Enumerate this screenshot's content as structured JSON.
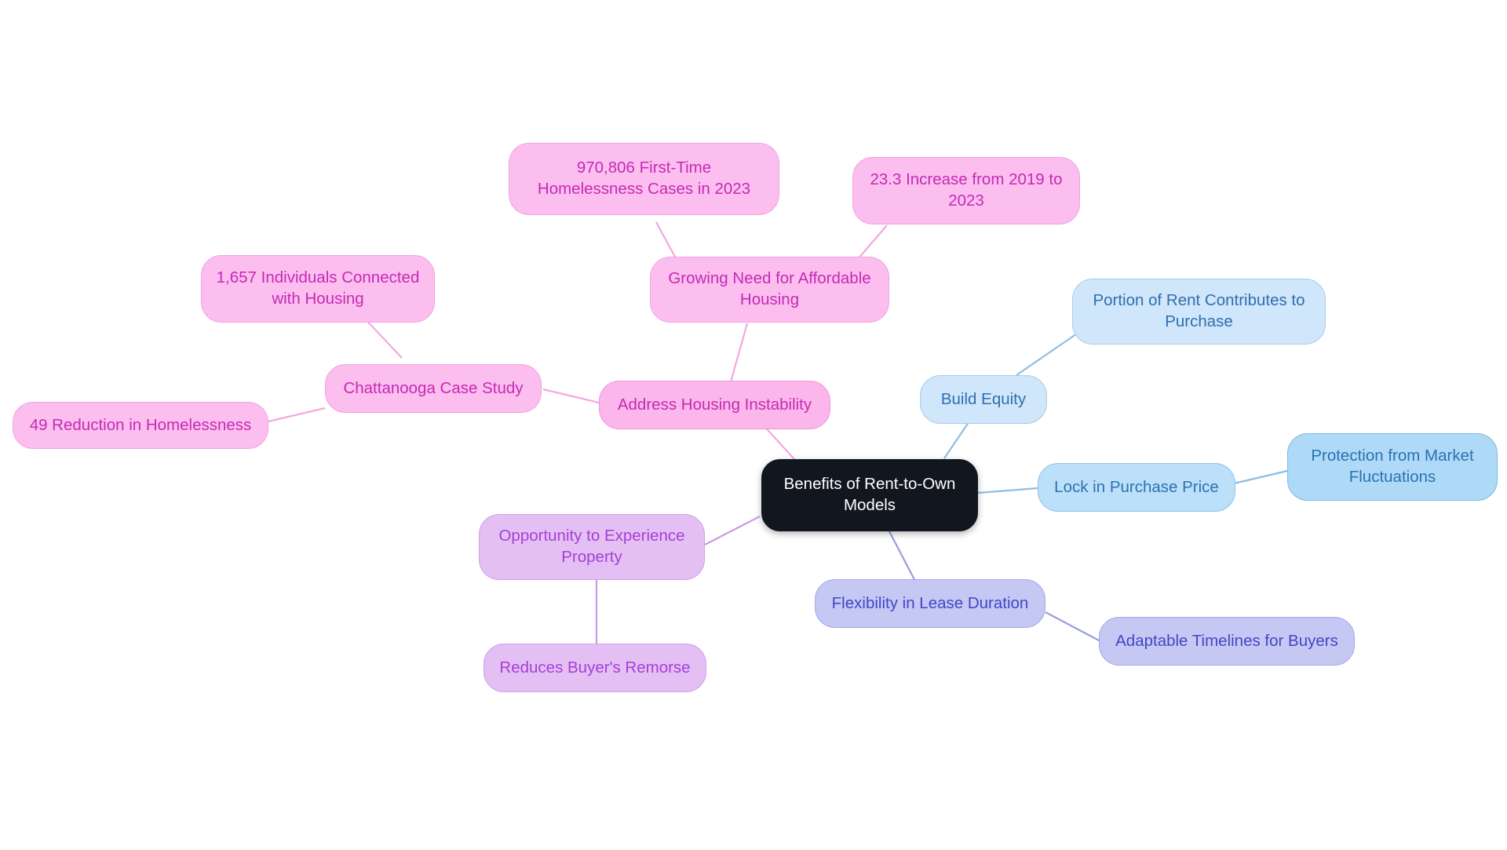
{
  "diagram": {
    "type": "mind-map",
    "title": "Benefits of Rent-to-Own Models",
    "background_color": "#ffffff",
    "branch_colors": {
      "pink": "#fbbeef",
      "blue": "#bcdffa",
      "indigo": "#c6c8f4",
      "violet": "#e3bff4",
      "root": "#11161f"
    }
  },
  "nodes": {
    "root": {
      "label": "Benefits of Rent-to-Own\nModels"
    },
    "address_housing_instability": {
      "label": "Address Housing Instability"
    },
    "growing_need": {
      "label": "Growing Need for Affordable\nHousing"
    },
    "first_time_cases": {
      "label": "970,806 First-Time\nHomelessness Cases in 2023"
    },
    "increase_2019_2023": {
      "label": "23.3 Increase from 2019 to\n2023"
    },
    "chattanooga": {
      "label": "Chattanooga Case Study"
    },
    "individuals_connected": {
      "label": "1,657 Individuals Connected\nwith Housing"
    },
    "reduction_homelessness": {
      "label": "49 Reduction in Homelessness"
    },
    "build_equity": {
      "label": "Build Equity"
    },
    "portion_of_rent": {
      "label": "Portion of Rent Contributes to\nPurchase"
    },
    "lock_in_price": {
      "label": "Lock in Purchase Price"
    },
    "protection_market": {
      "label": "Protection from Market\nFluctuations"
    },
    "flexibility_lease": {
      "label": "Flexibility in Lease Duration"
    },
    "adaptable_timelines": {
      "label": "Adaptable Timelines for Buyers"
    },
    "opportunity_experience": {
      "label": "Opportunity to Experience\nProperty"
    },
    "reduces_remorse": {
      "label": "Reduces Buyer's Remorse"
    }
  }
}
